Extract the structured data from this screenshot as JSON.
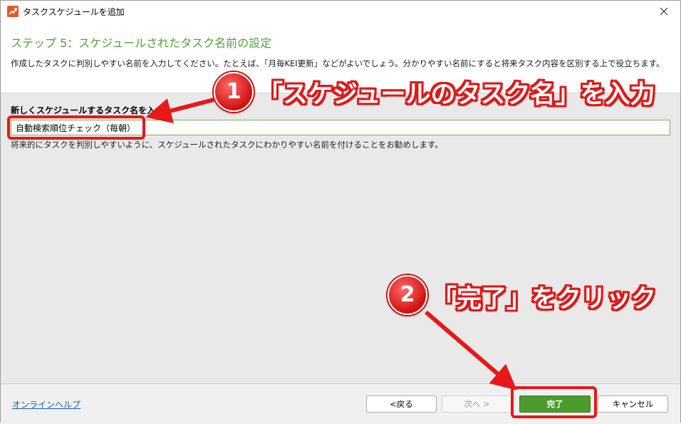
{
  "window": {
    "title": "タスクスケジュールを追加",
    "app_icon": "chart-up-icon",
    "close_icon": "close-icon"
  },
  "header": {
    "step_title": "ステップ 5：スケジュールされたタスク名前の設定",
    "description": "作成したタスクに判別しやすい名前を入力してください。たとえば、「月毎KEI更新」などがよいでしょう。分かりやすい名前にすると将来タスク内容を区別する上で役立ちます。"
  },
  "form": {
    "label": "新しくスケジュールするタスク名を入力",
    "task_name_value": "自動検索順位チェック（毎朝）",
    "help_text": "将来的にタスクを判別しやすいように、スケジュールされたタスクにわかりやすい名前を付けることをお勧めします。"
  },
  "footer": {
    "help_link": "オンラインヘルプ",
    "back_label": "<戻る",
    "next_label": "次へ >",
    "finish_label": "完了",
    "cancel_label": "キャンセル"
  },
  "annotations": {
    "badge_1": "1",
    "callout_1": "「スケジュールのタスク名」を入力",
    "badge_2": "2",
    "callout_2": "「完了」をクリック",
    "accent_color": "#e61818"
  },
  "colors": {
    "step_title": "#52a039",
    "finish_button": "#4d9a2e",
    "link": "#1a5fb4"
  }
}
